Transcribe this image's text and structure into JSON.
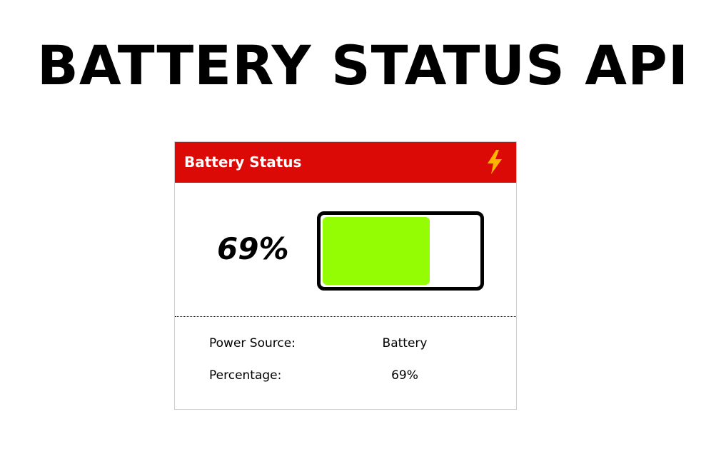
{
  "page": {
    "title": "BATTERY STATUS API"
  },
  "card": {
    "header_title": "Battery Status",
    "header_icon": "lightning-bolt-icon",
    "header_color": "#db0a07",
    "percent_display": "69%",
    "level_fraction": 0.69,
    "fill_color": "#94fc03",
    "info": {
      "power_source_label": "Power Source:",
      "power_source_value": "Battery",
      "percentage_label": "Percentage:",
      "percentage_value": "69%"
    }
  }
}
